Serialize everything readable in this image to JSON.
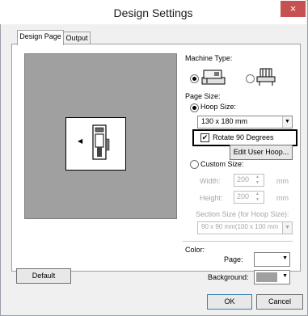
{
  "window": {
    "title": "Design Settings",
    "close_glyph": "×"
  },
  "tabs": [
    {
      "label": "Design Page"
    },
    {
      "label": "Output"
    }
  ],
  "machine_type": {
    "label": "Machine Type:",
    "options": [
      {
        "icon": "embroidery-machine-icon",
        "selected": true
      },
      {
        "icon": "multi-needle-machine-icon",
        "selected": false
      }
    ]
  },
  "page_size": {
    "label": "Page Size:",
    "hoop_size": {
      "label": "Hoop Size:",
      "selected": true,
      "value": "130 x 180 mm"
    },
    "rotate_90": {
      "label": "Rotate 90 Degrees",
      "checked": true
    },
    "edit_user_hoop": "Edit User Hoop...",
    "custom_size": {
      "label": "Custom Size:",
      "selected": false,
      "width": {
        "label": "Width:",
        "value": "200",
        "unit": "mm"
      },
      "height": {
        "label": "Height:",
        "value": "200",
        "unit": "mm"
      },
      "section_size_label": "Section Size (for Hoop Size):",
      "section_size_value": "90 x  90 mm(100 x 100 mm"
    }
  },
  "color": {
    "label": "Color:",
    "page_label": "Page:",
    "page_color": "#ffffff",
    "background_label": "Background:",
    "background_color": "#a0a0a0"
  },
  "buttons": {
    "default": "Default",
    "ok": "OK",
    "cancel": "Cancel"
  },
  "glyphs": {
    "check": "✔",
    "arrow_down": "▼",
    "arrow_left": "◀",
    "spin_up": "▲",
    "spin_down": "▼"
  }
}
